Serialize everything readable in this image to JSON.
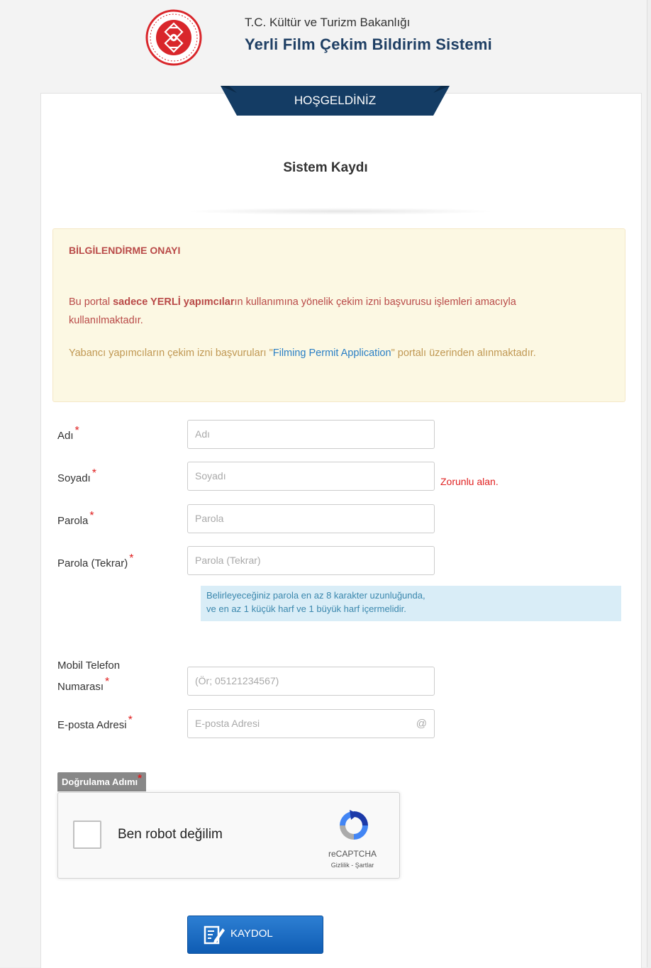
{
  "header": {
    "ministry": "T.C. Kültür ve Turizm Bakanlığı",
    "system_name": "Yerli Film Çekim Bildirim Sistemi"
  },
  "ribbon": "HOŞGELDİNİZ",
  "subtitle": "Sistem Kaydı",
  "notice": {
    "title": "BİLGİLENDİRME ONAYI",
    "p1_before": "Bu portal ",
    "p1_bold": "sadece YERLİ yapımcılar",
    "p1_after": "ın kullanımına yönelik çekim izni başvurusu işlemleri amacıyla kullanılmaktadır.",
    "p2_before": "Yabancı yapımcıların çekim izni başvuruları \"",
    "p2_link": "Filming Permit Application",
    "p2_after": "\" portalı üzerinden alınmaktadır."
  },
  "form": {
    "required_mark": "*",
    "first_name": {
      "label": "Adı",
      "placeholder": "Adı"
    },
    "last_name": {
      "label": "Soyadı",
      "placeholder": "Soyadı",
      "error": "Zorunlu alan."
    },
    "password": {
      "label": "Parola",
      "placeholder": "Parola"
    },
    "password_repeat": {
      "label": "Parola (Tekrar)",
      "placeholder": "Parola (Tekrar)"
    },
    "password_hint_line1": "Belirleyeceğiniz parola en az 8 karakter uzunluğunda,",
    "password_hint_line2": "ve en az 1 küçük harf ve 1 büyük harf içermelidir.",
    "phone": {
      "label_line1": "Mobil Telefon",
      "label_line2": "Numarası",
      "placeholder": "(Ör; 05121234567)"
    },
    "email": {
      "label": "E-posta Adresi",
      "placeholder": "E-posta Adresi",
      "icon_text": "@"
    },
    "verification_label": "Doğrulama Adımı",
    "submit_label": "KAYDOL"
  },
  "captcha": {
    "label": "Ben robot değilim",
    "brand": "reCAPTCHA",
    "links": "Gizlilik - Şartlar"
  },
  "colors": {
    "ribbon": "#143c64",
    "brand_red": "#d9262b",
    "button": "#1566c4",
    "error": "#e02020"
  }
}
